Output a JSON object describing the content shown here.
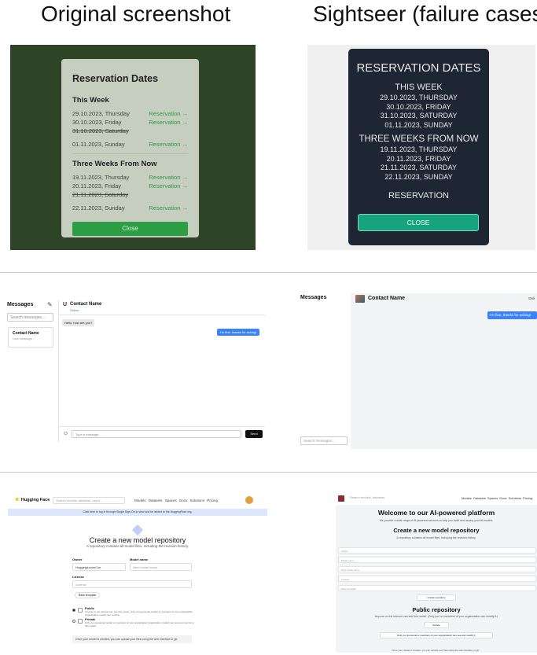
{
  "headings": {
    "left": "Original screenshot",
    "right": "Sightseer (failure cases)"
  },
  "row1": {
    "original": {
      "title": "Reservation Dates",
      "this_week_label": "This Week",
      "this_week": [
        {
          "date": "29.10.2023, Thursday",
          "link": "Reservation →"
        },
        {
          "date": "30.10.2023, Friday",
          "link": "Reservation →"
        },
        {
          "date": "31.10.2023, Saturday",
          "link": ""
        },
        {
          "date": "01.11.2023, Sunday",
          "link": "Reservation →"
        }
      ],
      "three_weeks_label": "Three Weeks From Now",
      "three_weeks": [
        {
          "date": "19.11.2023, Thursday",
          "link": "Reservation →"
        },
        {
          "date": "20.11.2023, Friday",
          "link": "Reservation →"
        },
        {
          "date": "21.11.2023, Saturday",
          "link": ""
        },
        {
          "date": "22.11.2023, Sunday",
          "link": "Reservation →"
        }
      ],
      "close": "Close"
    },
    "failure": {
      "title": "RESERVATION DATES",
      "this_week_label": "THIS WEEK",
      "this_week": [
        "29.10.2023, THURSDAY",
        "30.10.2023, FRIDAY",
        "31.10.2023, SATURDAY",
        "01.11.2023, SUNDAY"
      ],
      "three_weeks_label": "THREE WEEKS FROM NOW",
      "three_weeks": [
        "19.11.2023, THURSDAY",
        "20.11.2023, FRIDAY",
        "21.11.2023, SATURDAY",
        "22.11.2023, SUNDAY"
      ],
      "reservation": "RESERVATION",
      "close": "CLOSE"
    }
  },
  "row2": {
    "original": {
      "title": "Messages",
      "search": "Search messages...",
      "contact_name": "Contact Name",
      "last_message": "Last message...",
      "avatar_letter": "U",
      "header_name": "Contact Name",
      "status": "Online",
      "incoming": "Hello, how are you?",
      "outgoing": "I'm fine, thanks for asking!",
      "input_placeholder": "Type a message...",
      "send": "Send"
    },
    "failure": {
      "title": "Messages",
      "header_name": "Contact Name",
      "online": "Onli",
      "outgoing": "I'm fine, thanks for asking!",
      "search": "Search messages..."
    }
  },
  "row3": {
    "original": {
      "logo": "Hugging Face",
      "search": "Search models, datasets, users...",
      "nav": "Models  Datasets  Spaces  Docs  Solutions  Pricing",
      "banner": "Click here to log in through Single Sign-On to view and be added to the HuggingFace org.",
      "title": "Create a new model repository",
      "subtitle": "A repository contains all model files, including the revision history.",
      "owner_label": "Owner",
      "owner_value": "HuggingLearnCoe",
      "model_name_label": "Model name",
      "model_name_placeholder": "New model name",
      "license_label": "License",
      "license_placeholder": "License",
      "templates": "Base template",
      "public_label": "Public",
      "public_desc": "Anyone on the internet can see this model. Only you (personal model) or members of your organization (organization model) can commit.",
      "private_label": "Private",
      "private_desc": "Only you (personal model) or members of your organization (organization model) can see and commit to this model.",
      "note": "Once your model is created, you can upload your files using the web interface or git."
    },
    "failure": {
      "search": "Search models, datasets",
      "nav": "Models  Datasets  Spaces  Docs  Solutions  Pricing",
      "welcome": "Welcome to our AI-powered platform",
      "welcome_sub": "We provide a wide range of AI-powered services to help you build and deploy your AI models.",
      "title": "Create a new model repository",
      "subtitle": "A repository contains all model files, including the revision history.",
      "inputs": [
        "Owner",
        "Model name",
        "New model name",
        "License",
        "Base template"
      ],
      "create_button": "Create repository",
      "public_title": "Public repository",
      "public_desc": "Anyone on the internet can see this model. (Only you or members of your organization can modify it.)",
      "private_button": "Private",
      "private_desc": "Only you (personal or members of your organization) can see and modify it.",
      "footer": "Once your model is created, you can upload your files using the web interface or git."
    }
  }
}
